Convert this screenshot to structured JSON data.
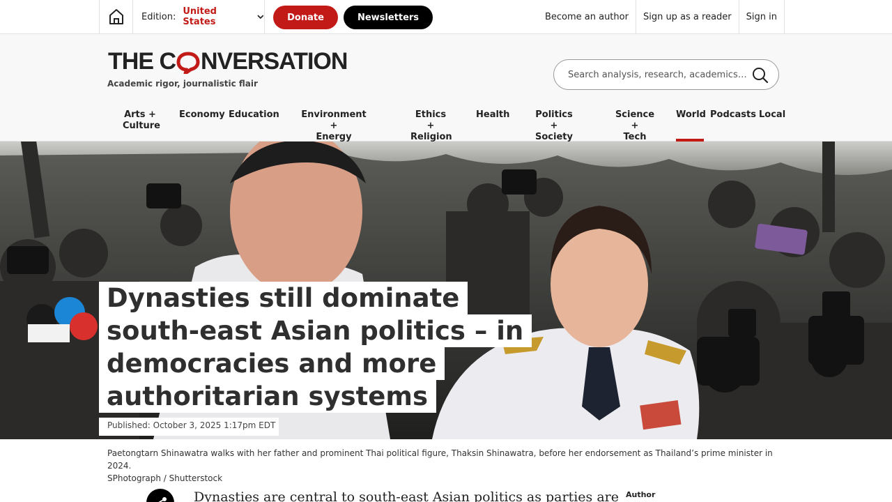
{
  "topbar": {
    "home_icon": "home-icon",
    "edition_label": "Edition:",
    "edition_value": "United States",
    "donate_label": "Donate",
    "newsletters_label": "Newsletters",
    "links": [
      "Become an author",
      "Sign up as a reader",
      "Sign in"
    ]
  },
  "masthead": {
    "logo_left": "THE C",
    "logo_right": "NVERSATION",
    "tagline": "Academic rigor, journalistic flair",
    "search_placeholder": "Search analysis, research, academics…"
  },
  "nav": {
    "items": [
      {
        "line1": "Arts +",
        "line2": "Culture"
      },
      {
        "line1": "Economy",
        "line2": ""
      },
      {
        "line1": "Education",
        "line2": ""
      },
      {
        "line1": "Environment +",
        "line2": "Energy"
      },
      {
        "line1": "Ethics +",
        "line2": "Religion"
      },
      {
        "line1": "Health",
        "line2": ""
      },
      {
        "line1": "Politics +",
        "line2": "Society"
      },
      {
        "line1": "Science +",
        "line2": "Tech"
      },
      {
        "line1": "World",
        "line2": ""
      },
      {
        "line1": "Podcasts",
        "line2": ""
      },
      {
        "line1": "Local",
        "line2": ""
      }
    ],
    "active": "World"
  },
  "article": {
    "headline_lines": [
      "Dynasties still dominate",
      "south-east Asian politics – in",
      "democracies and more",
      "authoritarian systems"
    ],
    "published": "Published: October 3, 2025 1:17pm EDT",
    "caption_line1": "Paetongtarn Shinawatra walks with her father and prominent Thai political figure, Thaksin Shinawatra, before her endorsement as Thailand’s prime minister in 2024.",
    "caption_line2": "SPhotograph / Shutterstock",
    "lede": "Dynasties are central to south-east Asian politics as parties are",
    "author_label": "Author"
  },
  "colors": {
    "accent": "#c21b17",
    "black": "#000000"
  }
}
